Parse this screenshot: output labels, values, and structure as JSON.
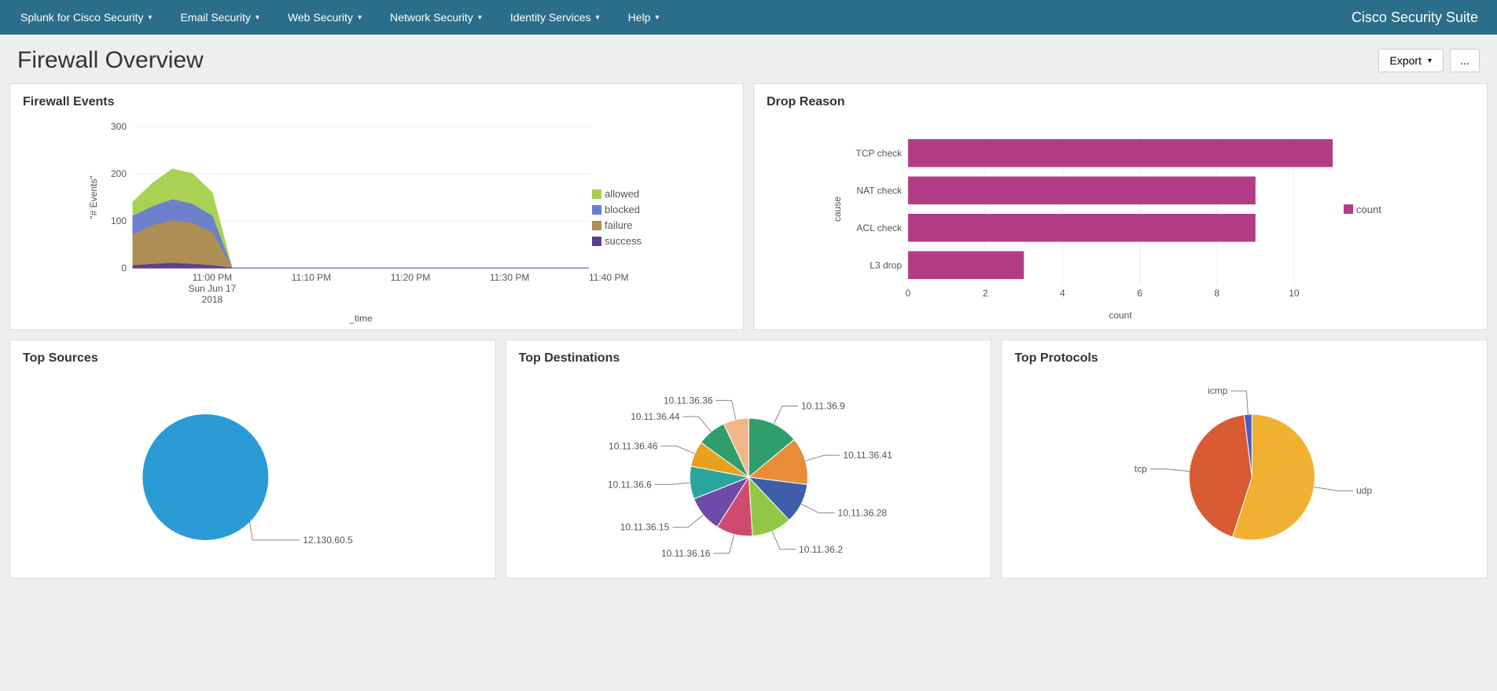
{
  "nav": {
    "items": [
      "Splunk for Cisco Security",
      "Email Security",
      "Web Security",
      "Network Security",
      "Identity Services",
      "Help"
    ],
    "brand": "Cisco Security Suite"
  },
  "page": {
    "title": "Firewall Overview",
    "export_label": "Export",
    "more_label": "..."
  },
  "panels": {
    "firewall_events_title": "Firewall Events",
    "drop_reason_title": "Drop Reason",
    "top_sources_title": "Top Sources",
    "top_destinations_title": "Top Destinations",
    "top_protocols_title": "Top Protocols"
  },
  "labels": {
    "events_y_axis": "\"# Events\"",
    "events_x_axis": "_time",
    "drop_y_axis": "cause",
    "drop_x_axis": "count",
    "drop_legend": "count",
    "firewall_date_line1": "Sun Jun 17",
    "firewall_date_line2": "2018"
  },
  "chart_data": [
    {
      "id": "firewall_events",
      "type": "area",
      "xlabel": "_time",
      "ylabel": "\"# Events\"",
      "ylim": [
        0,
        300
      ],
      "x_ticks": [
        "11:00 PM",
        "11:10 PM",
        "11:20 PM",
        "11:30 PM",
        "11:40 PM"
      ],
      "x_date": "Sun Jun 17 2018",
      "series": [
        {
          "name": "allowed",
          "color": "#a4cf4b",
          "values": [
            140,
            180,
            210,
            200,
            160,
            0,
            0,
            0,
            0,
            0,
            0,
            0,
            0,
            0,
            0,
            0,
            0,
            0,
            0,
            0,
            0,
            0,
            0,
            0
          ]
        },
        {
          "name": "blocked",
          "color": "#6a7bd3",
          "values": [
            110,
            130,
            145,
            135,
            110,
            0,
            0,
            0,
            0,
            0,
            0,
            0,
            0,
            0,
            0,
            0,
            0,
            0,
            0,
            0,
            0,
            0,
            0,
            0
          ]
        },
        {
          "name": "failure",
          "color": "#b08f4f",
          "values": [
            70,
            90,
            100,
            95,
            75,
            0,
            0,
            0,
            0,
            0,
            0,
            0,
            0,
            0,
            0,
            0,
            0,
            0,
            0,
            0,
            0,
            0,
            0,
            0
          ]
        },
        {
          "name": "success",
          "color": "#5a3e8c",
          "values": [
            5,
            8,
            10,
            8,
            5,
            0,
            0,
            0,
            0,
            0,
            0,
            0,
            0,
            0,
            0,
            0,
            0,
            0,
            0,
            0,
            0,
            0,
            0,
            0
          ]
        }
      ]
    },
    {
      "id": "drop_reason",
      "type": "bar",
      "orientation": "horizontal",
      "xlabel": "count",
      "ylabel": "cause",
      "xlim": [
        0,
        11
      ],
      "x_ticks": [
        0,
        2,
        4,
        6,
        8,
        10
      ],
      "legend": [
        "count"
      ],
      "categories": [
        "TCP check",
        "NAT check",
        "ACL check",
        "L3 drop"
      ],
      "values": [
        11,
        9,
        9,
        3
      ],
      "color": "#b33c86"
    },
    {
      "id": "top_sources",
      "type": "pie",
      "slices": [
        {
          "label": "12.130.60.5",
          "value": 100,
          "color": "#2b9bd6"
        }
      ]
    },
    {
      "id": "top_destinations",
      "type": "pie",
      "slices": [
        {
          "label": "10.11.36.9",
          "value": 14,
          "color": "#2f9e6d"
        },
        {
          "label": "10.11.36.41",
          "value": 13,
          "color": "#e98c3a"
        },
        {
          "label": "10.11.36.28",
          "value": 11,
          "color": "#3f5ea8"
        },
        {
          "label": "10.11.36.2",
          "value": 11,
          "color": "#92c746"
        },
        {
          "label": "10.11.36.16",
          "value": 10,
          "color": "#cf4a6e"
        },
        {
          "label": "10.11.36.15",
          "value": 10,
          "color": "#6f4aa8"
        },
        {
          "label": "10.11.36.6",
          "value": 9,
          "color": "#2aa59e"
        },
        {
          "label": "10.11.36.46",
          "value": 7,
          "color": "#e6a21f"
        },
        {
          "label": "10.11.36.44",
          "value": 8,
          "color": "#2f9e6d"
        },
        {
          "label": "10.11.36.36",
          "value": 7,
          "color": "#f0b58a"
        }
      ]
    },
    {
      "id": "top_protocols",
      "type": "pie",
      "slices": [
        {
          "label": "udp",
          "value": 55,
          "color": "#f0b132"
        },
        {
          "label": "tcp",
          "value": 43,
          "color": "#d95b33"
        },
        {
          "label": "icmp",
          "value": 2,
          "color": "#4a5dbf"
        }
      ]
    }
  ]
}
